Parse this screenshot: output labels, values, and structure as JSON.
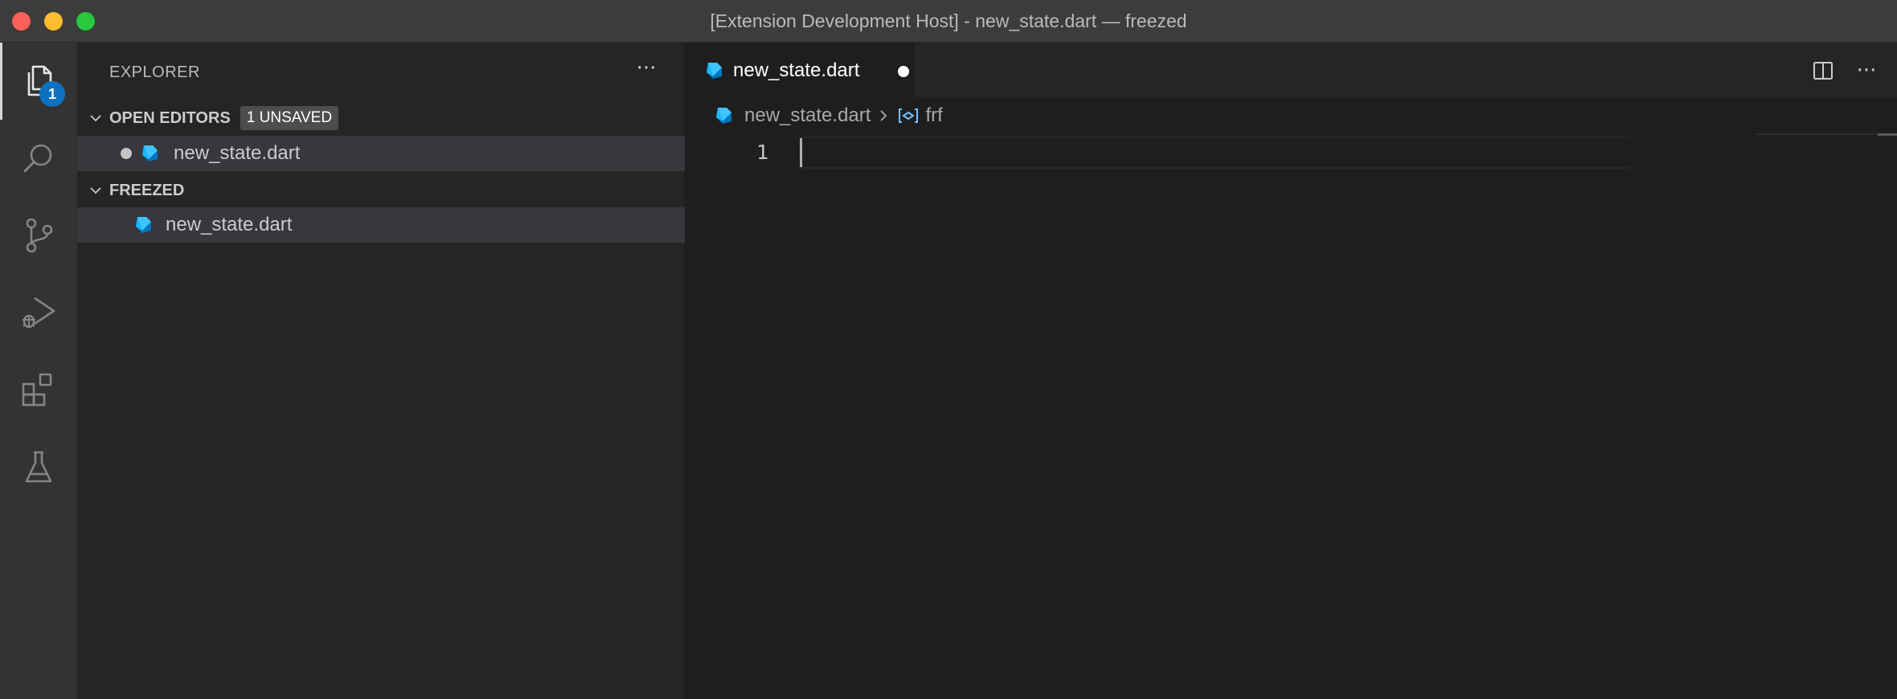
{
  "window": {
    "title": "[Extension Development Host] - new_state.dart — freezed"
  },
  "activity_bar": {
    "items": [
      {
        "name": "explorer",
        "icon": "files-icon",
        "active": true,
        "badge": "1"
      },
      {
        "name": "search",
        "icon": "search-icon"
      },
      {
        "name": "source-control",
        "icon": "source-control-icon"
      },
      {
        "name": "run-and-debug",
        "icon": "run-debug-icon"
      },
      {
        "name": "extensions",
        "icon": "extensions-icon"
      },
      {
        "name": "testing",
        "icon": "beaker-icon"
      }
    ]
  },
  "sidebar": {
    "header": "EXPLORER",
    "more_label": "···",
    "open_editors": {
      "label": "OPEN EDITORS",
      "badge": "1 UNSAVED",
      "files": [
        {
          "name": "new_state.dart",
          "dirty": true
        }
      ]
    },
    "workspace": {
      "label": "FREEZED",
      "files": [
        {
          "name": "new_state.dart"
        }
      ]
    }
  },
  "editor": {
    "tab": {
      "label": "new_state.dart",
      "dirty": true
    },
    "actions": {
      "split_icon": "split-editor-icon",
      "more_label": "···"
    },
    "breadcrumbs": {
      "file": "new_state.dart",
      "symbol": "frf"
    },
    "lines": [
      {
        "number": "1",
        "text": ""
      }
    ]
  },
  "colors": {
    "badge": "#0e70c0",
    "dart_blue": "#40c4ff",
    "dart_dark": "#0175c2",
    "symbol_blue": "#75beff"
  }
}
